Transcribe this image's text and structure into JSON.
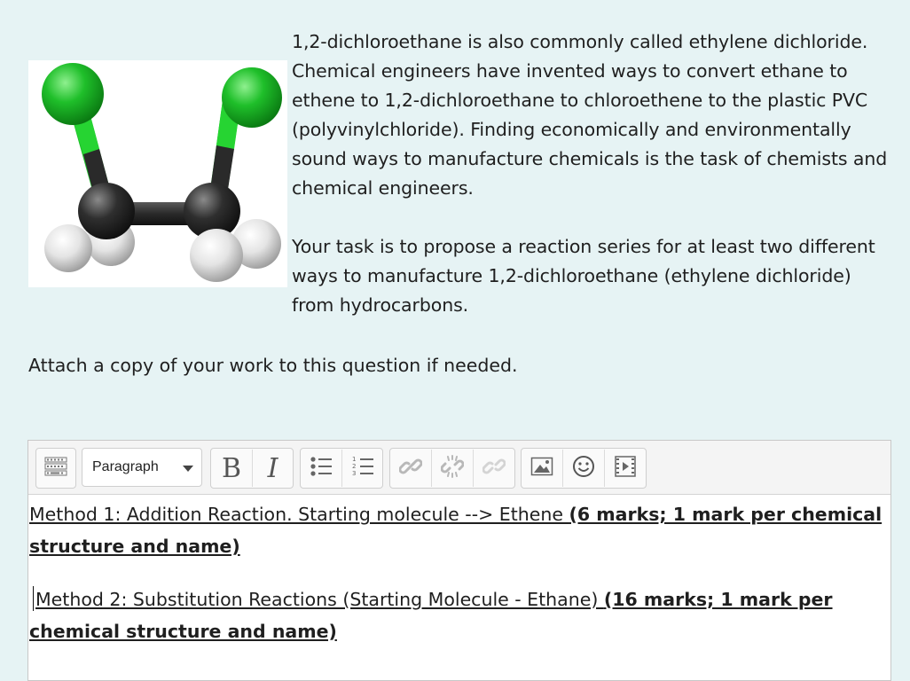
{
  "question": {
    "paragraph1": "1,2-dichloroethane is also commonly called ethylene dichloride. Chemical engineers have invented ways to convert ethane to ethene to 1,2-dichloroethane to chloroethene to the plastic PVC (polyvinylchloride). Finding economically and environmentally sound ways to manufacture chemicals is the task of chemists and chemical engineers.",
    "paragraph2": "Your task is to propose a reaction series for at least two different ways to manufacture 1,2-dichloroethane (ethylene dichloride) from hydrocarbons.",
    "attach_note": "Attach a copy of your work to this question if needed."
  },
  "toolbar": {
    "paragraph_select": "Paragraph",
    "bold_label": "B",
    "italic_label": "I"
  },
  "editor": {
    "method1_text": "Method 1: Addition Reaction.  Starting molecule --> Ethene ",
    "method1_marks": "(6 marks; 1 mark per chemical structure and name)",
    "method2_text": "Method 2: Substitution Reactions (Starting Molecule - Ethane) ",
    "method2_marks": "(16 marks; 1 mark per chemical structure and name)"
  },
  "colors": {
    "chlorine": "#1fbf2a",
    "carbon": "#2b2b2b",
    "hydrogen": "#e8e8e8",
    "background": "#e6f3f4"
  },
  "icons": [
    "molecule-image",
    "show-more-icon",
    "bold-icon",
    "italic-icon",
    "unordered-list-icon",
    "ordered-list-icon",
    "link-icon",
    "unlink-icon",
    "link-disabled-icon",
    "image-icon",
    "emoji-icon",
    "media-icon"
  ]
}
